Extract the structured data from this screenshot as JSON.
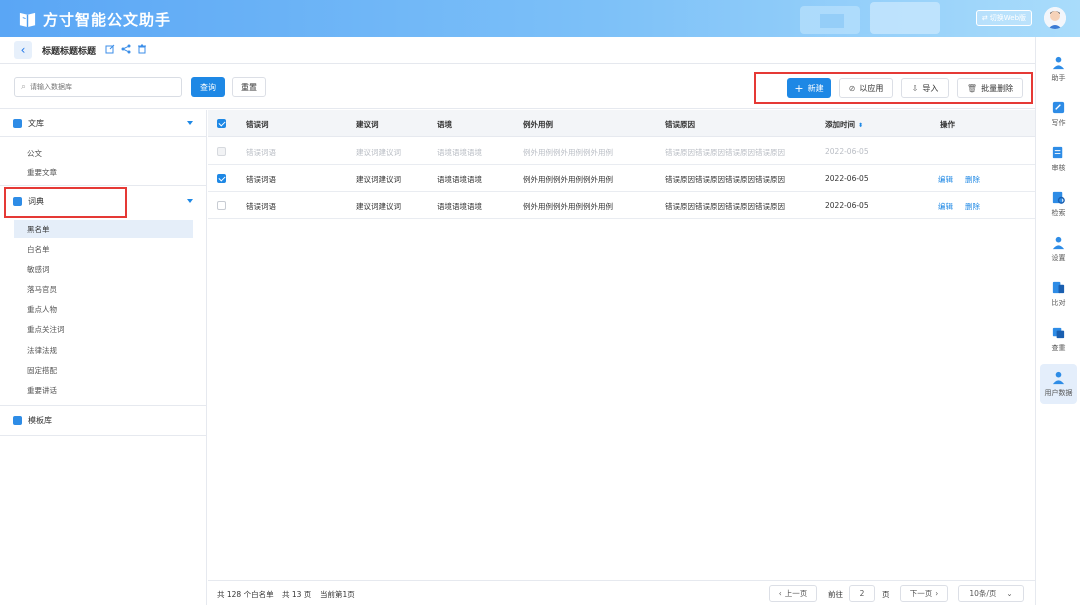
{
  "header": {
    "app_title": "方寸智能公文助手",
    "switch_label": "切换Web版"
  },
  "titlebar": {
    "doc_title": "标题标题标题"
  },
  "toolbar": {
    "search_placeholder": "请输入数据库",
    "query_label": "查询",
    "reset_label": "重置",
    "new_label": "新建",
    "applied_label": "以应用",
    "import_label": "导入",
    "batch_delete_label": "批量删除"
  },
  "sidebar": {
    "groups": [
      {
        "label": "文库",
        "items": [
          "公文",
          "重要文章"
        ]
      },
      {
        "label": "词典",
        "items": [
          "黑名单",
          "白名单",
          "敏感词",
          "落马官员",
          "重点人物",
          "重点关注词",
          "法律法规",
          "固定搭配",
          "重要讲话"
        ],
        "selected": "黑名单"
      },
      {
        "label": "模板库",
        "items": []
      }
    ]
  },
  "table": {
    "headers": [
      "错误词",
      "建议词",
      "语境",
      "例外用例",
      "错误原因",
      "添加时间",
      "操作"
    ],
    "rows": [
      {
        "error": "错误词语",
        "suggest": "建议词建议词",
        "context": "语境语境语境",
        "exception": "例外用例例外用例例外用例",
        "reason": "错误原因错误原因错误原因错误原因",
        "time": "2022-06-05",
        "state": "disabled",
        "checked": false
      },
      {
        "error": "错误词语",
        "suggest": "建议词建议词",
        "context": "语境语境语境",
        "exception": "例外用例例外用例例外用例",
        "reason": "错误原因错误原因错误原因错误原因",
        "time": "2022-06-05",
        "state": "normal",
        "checked": true,
        "edit": "编辑",
        "delete": "删除"
      },
      {
        "error": "错误词语",
        "suggest": "建议词建议词",
        "context": "语境语境语境",
        "exception": "例外用例例外用例例外用例",
        "reason": "错误原因错误原因错误原因错误原因",
        "time": "2022-06-05",
        "state": "normal",
        "checked": false,
        "edit": "编辑",
        "delete": "删除"
      }
    ]
  },
  "footer": {
    "total_text": "共 128 个白名单",
    "pages_text": "共 13 页",
    "current_text": "当前第1页",
    "prev_label": "上一页",
    "goto_label": "前往",
    "page_value": "2",
    "page_unit": "页",
    "next_label": "下一页",
    "page_size_label": "10条/页"
  },
  "rail": {
    "items": [
      {
        "label": "助手",
        "icon": "assistant-icon"
      },
      {
        "label": "写作",
        "icon": "write-icon"
      },
      {
        "label": "审核",
        "icon": "review-icon"
      },
      {
        "label": "检索",
        "icon": "search-doc-icon"
      },
      {
        "label": "设置",
        "icon": "settings-icon"
      },
      {
        "label": "比对",
        "icon": "compare-icon"
      },
      {
        "label": "查重",
        "icon": "dedup-icon"
      },
      {
        "label": "用户数据",
        "icon": "user-data-icon"
      }
    ],
    "active": "用户数据"
  },
  "colors": {
    "accent": "#1e88e5",
    "highlight_box": "#e53935"
  }
}
